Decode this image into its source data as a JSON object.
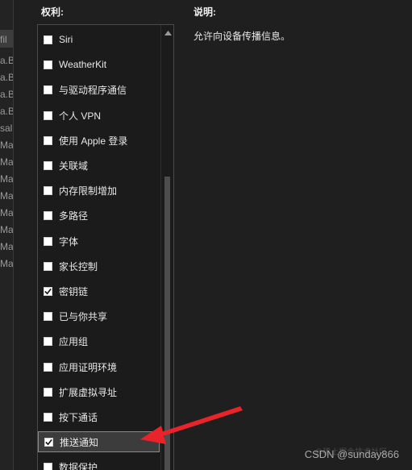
{
  "left_panel": {
    "fragments": [
      "fil",
      "a.B",
      "a.B",
      "a.B",
      "a.B",
      "sal",
      "Ma",
      "Ma",
      "Ma",
      "Ma",
      "Ma",
      "Ma",
      "Ma",
      "Ma",
      "Ma"
    ]
  },
  "entitlements": {
    "header": "权利:",
    "items": [
      {
        "label": "Siri",
        "checked": false
      },
      {
        "label": "WeatherKit",
        "checked": false
      },
      {
        "label": "与驱动程序通信",
        "checked": false
      },
      {
        "label": "个人 VPN",
        "checked": false
      },
      {
        "label": "使用 Apple 登录",
        "checked": false
      },
      {
        "label": "关联域",
        "checked": false
      },
      {
        "label": "内存限制增加",
        "checked": false
      },
      {
        "label": "多路径",
        "checked": false
      },
      {
        "label": "字体",
        "checked": false
      },
      {
        "label": "家长控制",
        "checked": false
      },
      {
        "label": "密钥链",
        "checked": true
      },
      {
        "label": "已与你共享",
        "checked": false
      },
      {
        "label": "应用组",
        "checked": false
      },
      {
        "label": "应用证明环境",
        "checked": false
      },
      {
        "label": "扩展虚拟寻址",
        "checked": false
      },
      {
        "label": "按下通话",
        "checked": false
      },
      {
        "label": "推送通知",
        "checked": true,
        "highlighted": true
      },
      {
        "label": "数据保护",
        "checked": false
      }
    ]
  },
  "description": {
    "header": "说明:",
    "text": "允许向设备传播信息。"
  },
  "colors": {
    "background": "#1f1f1f",
    "arrow": "#e8242a",
    "highlight": "#3c3c3c"
  },
  "watermark": {
    "faint": "@稀土掘金技术社区",
    "text": "CSDN @sunday866"
  }
}
